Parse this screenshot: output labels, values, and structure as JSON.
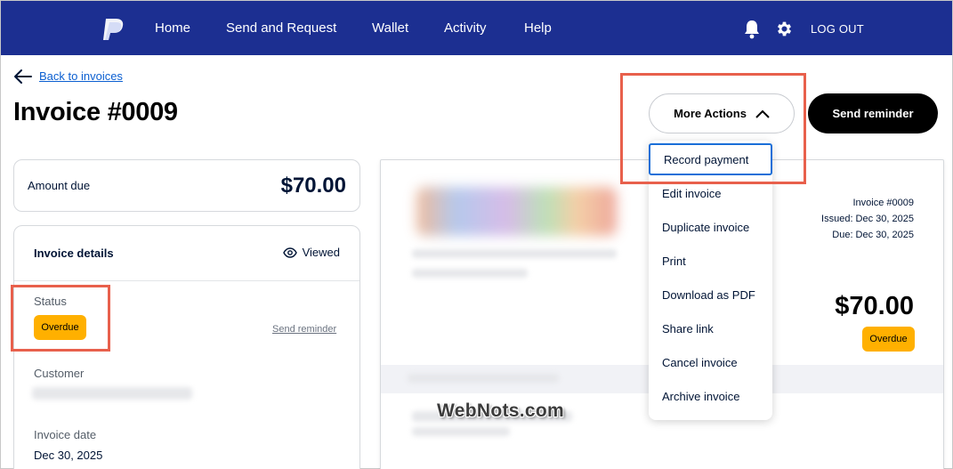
{
  "nav": {
    "links": [
      "Home",
      "Send and Request",
      "Wallet",
      "Activity",
      "Help"
    ],
    "logout": "LOG OUT",
    "brand_color": "#1c2f91"
  },
  "back_link": "Back to invoices",
  "title": "Invoice #0009",
  "actions": {
    "more_actions": "More Actions",
    "send_reminder": "Send reminder"
  },
  "menu": {
    "items": [
      "Record payment",
      "Edit invoice",
      "Duplicate invoice",
      "Print",
      "Download as PDF",
      "Share link",
      "Cancel invoice",
      "Archive invoice"
    ],
    "focused_item": "Record payment"
  },
  "amount_card": {
    "label": "Amount due",
    "value": "$70.00"
  },
  "details": {
    "header": "Invoice details",
    "viewed": "Viewed",
    "status_label": "Status",
    "status_badge": "Overdue",
    "send_reminder_link": "Send reminder",
    "customer_label": "Customer",
    "invoice_date_label": "Invoice date",
    "invoice_date_value": "Dec 30, 2025"
  },
  "preview": {
    "invoice_no": "Invoice #0009",
    "issued": "Issued: Dec 30, 2025",
    "due": "Due: Dec 30, 2025",
    "amount": "$70.00",
    "status_badge": "Overdue"
  },
  "watermark": "WebNots.com",
  "colors": {
    "overdue": "#ffb000",
    "highlight": "#e8604c",
    "focus": "#1a6fd8"
  }
}
